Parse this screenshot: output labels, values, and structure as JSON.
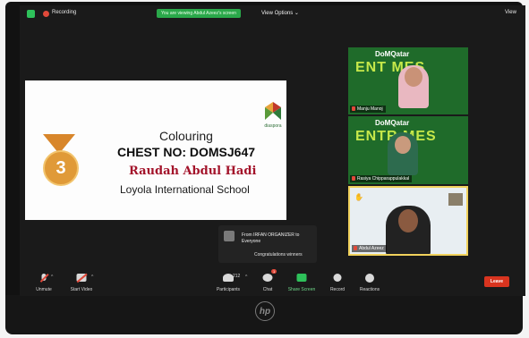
{
  "topbar": {
    "recording_label": "Recording",
    "viewing_notice": "You are viewing Abdul Azeez's screen",
    "view_options_label": "View Options ⌄",
    "view_label": "View"
  },
  "shared_slide": {
    "title": "Colouring",
    "chest_no": "CHEST NO: DOMSJ647",
    "student_name": "Raudah Abdul Hadi",
    "school": "Loyola International School",
    "medal_rank": "3",
    "logo_caption": "diaspora"
  },
  "video_tiles": [
    {
      "name": "Manju Manoj",
      "banner_top": "DoMQatar",
      "banner_main": "ENT MES"
    },
    {
      "name": "Rasiya Chipparappulakkal",
      "banner_top": "DoMQatar",
      "banner_main": "ENTR MES"
    },
    {
      "name": "Abdul Azeez"
    }
  ],
  "chat_toast": {
    "from": "From IRFAN ORGANIZER to Everyone",
    "message": "Congratulations winners"
  },
  "toolbar": {
    "unmute": "Unmute",
    "start_video": "Start Video",
    "participants": "Participants",
    "participants_count": "212",
    "chat": "Chat",
    "chat_badge": "1",
    "share_screen": "Share Screen",
    "record": "Record",
    "reactions": "Reactions",
    "leave": "Leave"
  },
  "brand": {
    "laptop_logo": "hp"
  },
  "colors": {
    "accent_green": "#2ec15a",
    "leave_red": "#d8341f",
    "student_name": "#a3132a"
  }
}
